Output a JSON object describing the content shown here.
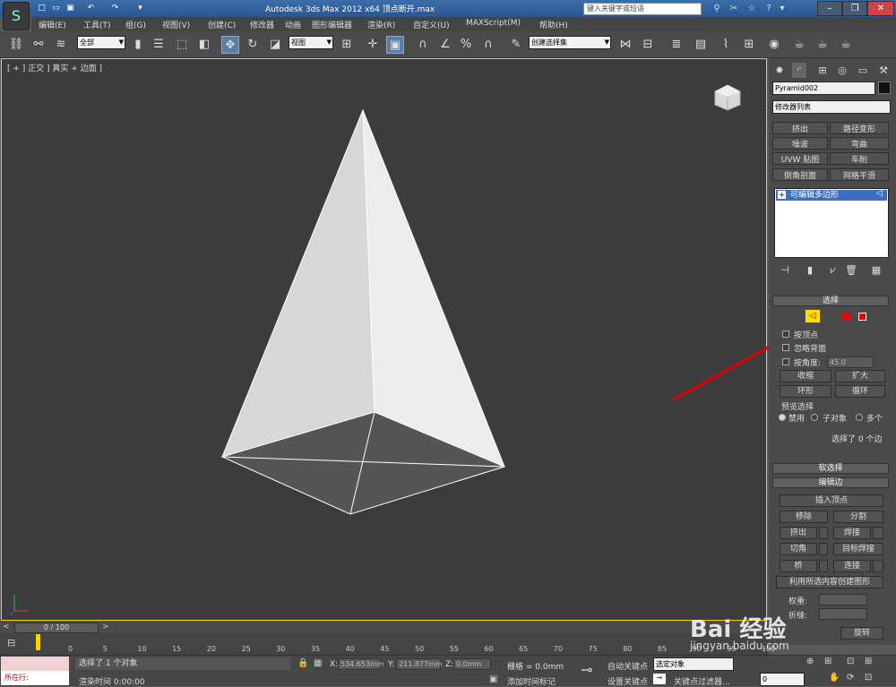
{
  "title_bar": {
    "title": "Autodesk 3ds Max  2012 x64      顶点断开.max",
    "search_placeholder": "键入关键字或短语"
  },
  "menu": [
    "编辑(E)",
    "工具(T)",
    "组(G)",
    "视图(V)",
    "创建(C)",
    "修改器",
    "动画",
    "图形编辑器",
    "渲染(R)",
    "自定义(U)",
    "MAXScript(M)",
    "帮助(H)"
  ],
  "toolbar": {
    "selection_filter": "全部",
    "reference_coord": "视图",
    "named_selection": "创建选择集"
  },
  "viewport": {
    "label": "[ + ] 正交 ] 真实 + 边面 ]"
  },
  "command_panel": {
    "object_name": "Pyramid002",
    "modifier_list": "修改器列表",
    "modifier_buttons": [
      "挤出",
      "路径变形",
      "噪波",
      "弯曲",
      "UVW 贴图",
      "车削",
      "倒角剖面",
      "网格平滑"
    ],
    "stack_item": "可编辑多边形",
    "selection": {
      "header": "选择",
      "by_vertex": "按顶点",
      "ignore_backfacing": "忽略背面",
      "by_angle": "按角度:",
      "angle_value": "45.0",
      "shrink": "收缩",
      "grow": "扩大",
      "ring": "环形",
      "loop": "循环",
      "preview_selection": "预览选择",
      "preview_options": [
        "禁用",
        "子对象",
        "多个"
      ],
      "status": "选择了 0 个边"
    },
    "soft_selection": "软选择",
    "edit_edges": {
      "header": "编辑边",
      "insert_vertex": "插入顶点",
      "remove": "移除",
      "split": "分割",
      "extrude": "挤出",
      "weld": "焊接",
      "chamfer": "切角",
      "target_weld": "目标焊接",
      "bridge": "桥",
      "connect": "连接",
      "create_shape": "利用所选内容创建图形",
      "weight": "权重:",
      "crease": "折缝:",
      "rotate": "旋转"
    }
  },
  "timeline": {
    "slider": "0 / 100",
    "ticks": [
      "0",
      "5",
      "10",
      "15",
      "20",
      "25",
      "30",
      "35",
      "40",
      "45",
      "50",
      "55",
      "60",
      "65",
      "70",
      "75",
      "80",
      "85",
      "90",
      "95",
      "100"
    ]
  },
  "status": {
    "maxscript_label": "所在行:",
    "selected": "选择了 1 个对象",
    "render_time": "渲染时间  0:00:00",
    "x_label": "X:",
    "x_value": "534.653mm",
    "y_label": "Y:",
    "y_value": "211.877mm",
    "z_label": "Z:",
    "z_value": "0.0mm",
    "grid": "栅格 = 0.0mm",
    "add_time_tag": "添加时间标记",
    "auto_key": "自动关键点",
    "selected_obj": "选定对象",
    "set_key": "设置关键点",
    "key_filters": "关键点过滤器...",
    "frame": "0"
  },
  "watermark": {
    "main": "Bai 经验",
    "sub": "jingyan.baidu.com"
  },
  "colors": {
    "viewport_border": "#ffd200",
    "highlight_circle": "#e00000",
    "edge_mode_button": "#ffe000",
    "stack_selected": "#3d6fc4"
  }
}
